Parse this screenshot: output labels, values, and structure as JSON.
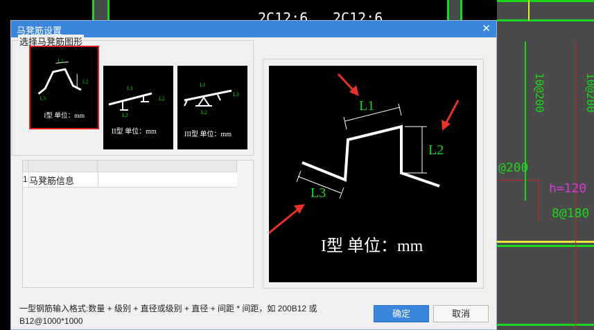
{
  "cad_background": {
    "labels": [
      "2C12:6",
      "2C12:6",
      "10@200",
      "10@200",
      "@200",
      "h=120",
      "8@180"
    ]
  },
  "dialog": {
    "title": "马凳筋设置",
    "close_glyph": "✕",
    "group_label": "选择马凳筋图形",
    "shapes": [
      {
        "caption": "I型 单位：mm",
        "selected": true
      },
      {
        "caption": "II型 单位：mm",
        "selected": false
      },
      {
        "caption": "III型 单位：mm",
        "selected": false
      }
    ],
    "dim_labels": {
      "l1": "L1",
      "l2": "L2",
      "l3": "L3"
    },
    "grid": {
      "rows": [
        {
          "index": "1",
          "label": "马凳筋信息",
          "value": ""
        }
      ]
    },
    "preview_caption": "I型 单位：mm",
    "note": "一型钢筋输入格式:数量 + 级别 + 直径或级别 + 直径 + 间距 * 间距，如 200B12 或 B12@1000*1000",
    "ok_label": "确定",
    "cancel_label": "取消"
  },
  "colors": {
    "accent": "#3a86dc",
    "cad_green": "#1bd51b",
    "selection_red": "#e02020",
    "arrow_red": "#e8322b"
  }
}
